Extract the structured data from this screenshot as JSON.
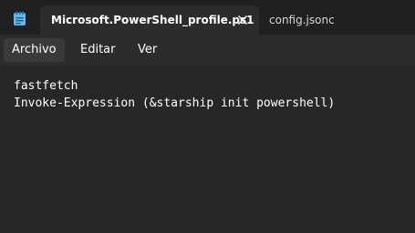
{
  "tabs": [
    {
      "title": "Microsoft.PowerShell_profile.ps1",
      "active": true
    },
    {
      "title": "config.jsonc",
      "active": false
    }
  ],
  "menu": {
    "items": [
      "Archivo",
      "Editar",
      "Ver"
    ]
  },
  "editor": {
    "lines": [
      "fastfetch",
      "Invoke-Expression (&starship init powershell)"
    ]
  },
  "colors": {
    "tabbar_bg": "#202020",
    "surface_bg": "#2c2c2c",
    "editor_bg": "#272727",
    "icon_accent": "#5fb8f0",
    "text": "#ffffff"
  },
  "icons": {
    "app": "notepad-icon",
    "close": "close-icon"
  }
}
